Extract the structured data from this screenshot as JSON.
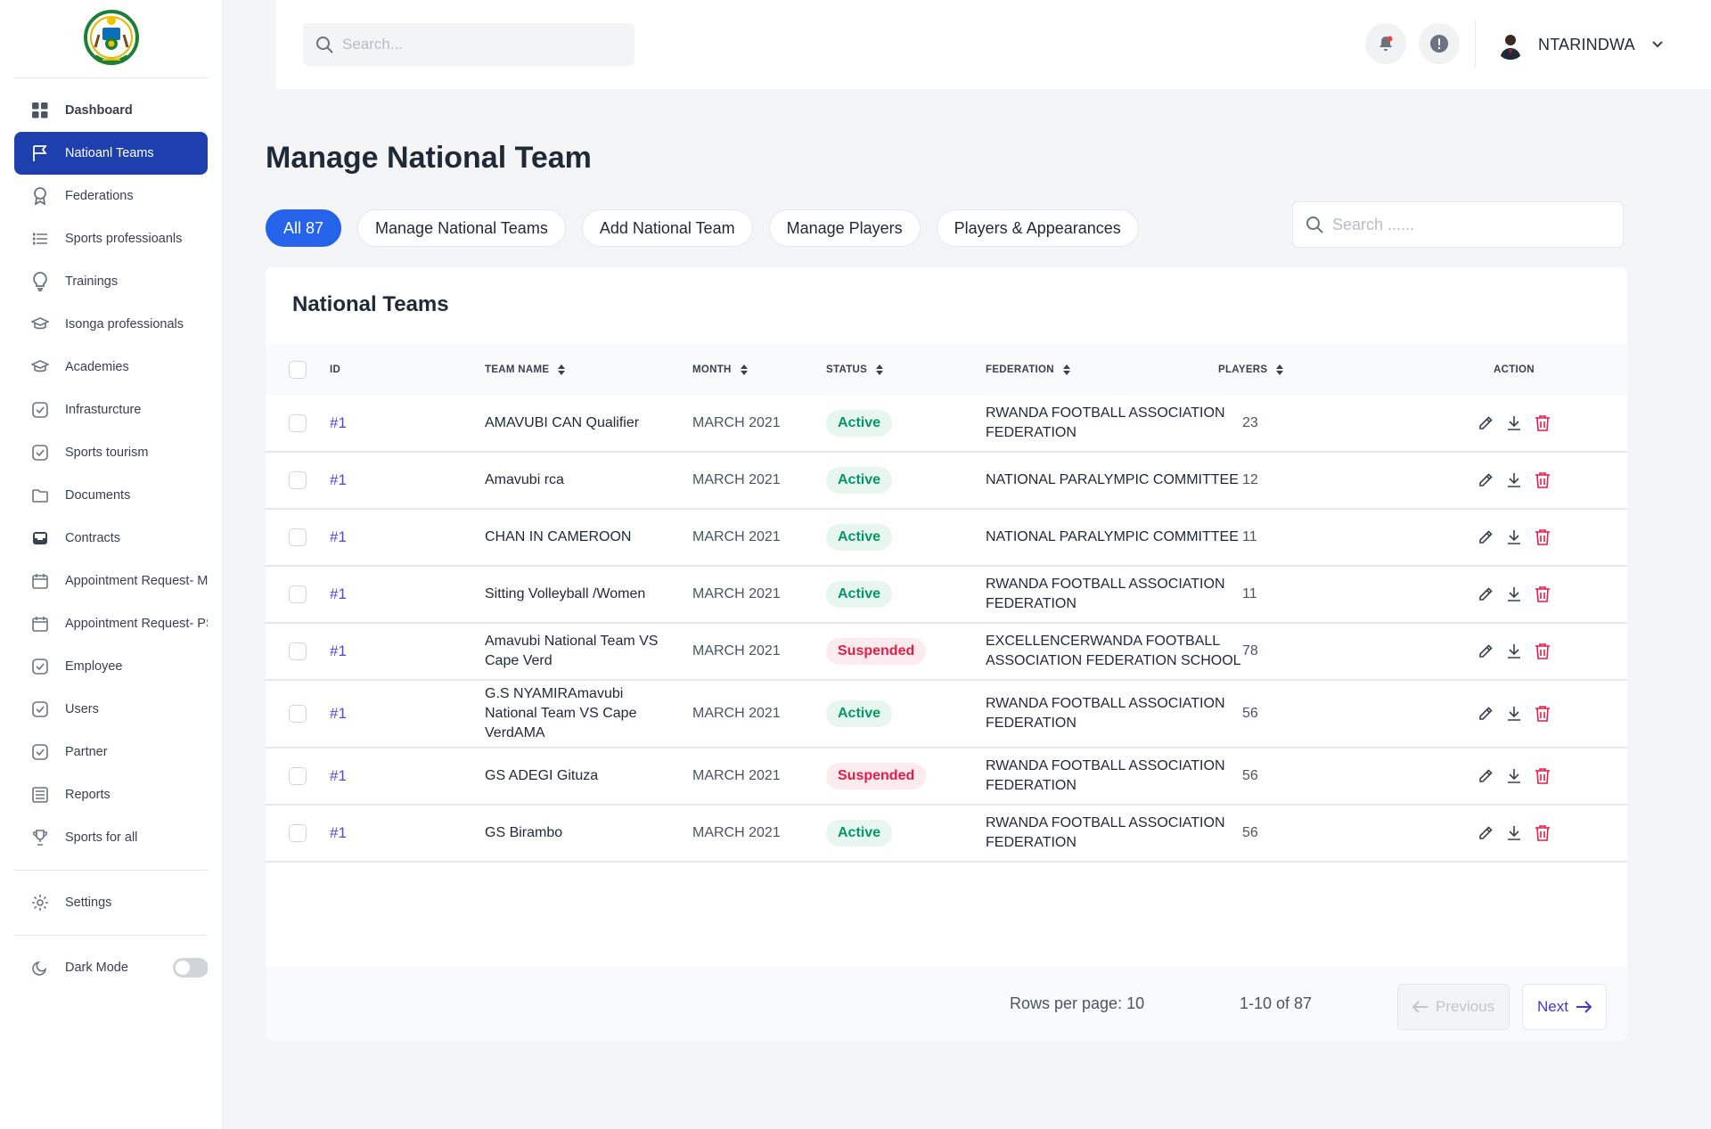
{
  "sidebar": {
    "items": [
      {
        "label": "Dashboard",
        "icon": "grid-icon"
      },
      {
        "label": "Natioanl Teams",
        "icon": "flag-icon"
      },
      {
        "label": "Federations",
        "icon": "award-icon"
      },
      {
        "label": "Sports professioanls",
        "icon": "list-icon"
      },
      {
        "label": "Trainings",
        "icon": "lightbulb-icon"
      },
      {
        "label": "Isonga professionals",
        "icon": "graduation-cap-icon"
      },
      {
        "label": "Academies",
        "icon": "graduation-cap-icon"
      },
      {
        "label": "Infrasturcture",
        "icon": "check-square-icon"
      },
      {
        "label": "Sports tourism",
        "icon": "check-square-icon"
      },
      {
        "label": "Documents",
        "icon": "folder-icon"
      },
      {
        "label": "Contracts",
        "icon": "inbox-icon"
      },
      {
        "label": "Appointment Request- MINISTER",
        "icon": "calendar-icon"
      },
      {
        "label": "Appointment Request- PS",
        "icon": "calendar-icon"
      },
      {
        "label": "Employee",
        "icon": "check-square-icon"
      },
      {
        "label": "Users",
        "icon": "check-square-icon"
      },
      {
        "label": "Partner",
        "icon": "check-square-icon"
      },
      {
        "label": "Reports",
        "icon": "report-icon"
      },
      {
        "label": "Sports for all",
        "icon": "trophy-icon"
      }
    ],
    "settings": "Settings",
    "dark_mode": "Dark Mode"
  },
  "topbar": {
    "search_placeholder": "Search...",
    "user_name": "NTARINDWA"
  },
  "main": {
    "title": "Manage National Team",
    "tabs": [
      {
        "label": "All 87"
      },
      {
        "label": "Manage National Teams"
      },
      {
        "label": "Add National Team"
      },
      {
        "label": "Manage Players"
      },
      {
        "label": "Players & Appearances"
      }
    ],
    "search_placeholder": "Search ......",
    "card_title": "National Teams",
    "columns": {
      "id": "ID",
      "team_name": "TEAM NAME",
      "month": "MONTH",
      "status": "STATUS",
      "federation": "FEDERATION",
      "players": "PLAYERS",
      "action": "ACTION"
    },
    "rows": [
      {
        "id": "#1",
        "team": "AMAVUBI CAN Qualifier",
        "month": "MARCH 2021",
        "status": "Active",
        "federation": "RWANDA FOOTBALL ASSOCIATION FEDERATION",
        "players": "23"
      },
      {
        "id": "#1",
        "team": "Amavubi rca",
        "month": "MARCH 2021",
        "status": "Active",
        "federation": "NATIONAL PARALYMPIC COMMITTEE",
        "players": "12"
      },
      {
        "id": "#1",
        "team": "CHAN IN CAMEROON",
        "month": "MARCH 2021",
        "status": "Active",
        "federation": "NATIONAL PARALYMPIC COMMITTEE",
        "players": "11"
      },
      {
        "id": "#1",
        "team": "Sitting Volleyball /Women",
        "month": "MARCH 2021",
        "status": "Active",
        "federation": "RWANDA FOOTBALL ASSOCIATION FEDERATION",
        "players": "11"
      },
      {
        "id": "#1",
        "team": "Amavubi National Team VS Cape Verd",
        "month": "MARCH 2021",
        "status": "Suspended",
        "federation": "EXCELLENCERWANDA FOOTBALL ASSOCIATION FEDERATION SCHOOL",
        "players": "78"
      },
      {
        "id": "#1",
        "team": "G.S NYAMIRAmavubi National Team VS Cape VerdAMA",
        "month": "MARCH 2021",
        "status": "Active",
        "federation": "RWANDA FOOTBALL ASSOCIATION FEDERATION",
        "players": "56"
      },
      {
        "id": "#1",
        "team": "GS ADEGI Gituza",
        "month": "MARCH 2021",
        "status": "Suspended",
        "federation": "RWANDA FOOTBALL ASSOCIATION FEDERATION",
        "players": "56"
      },
      {
        "id": "#1",
        "team": "GS Birambo",
        "month": "MARCH 2021",
        "status": "Active",
        "federation": "RWANDA FOOTBALL ASSOCIATION FEDERATION",
        "players": "56"
      }
    ],
    "pagination": {
      "rows_per_page": "Rows per page: 10",
      "range": "1-10 of 87",
      "previous": "Previous",
      "next": "Next"
    }
  },
  "colors": {
    "primary": "#1e3fae",
    "accent": "#2563eb",
    "active_green": "#059669",
    "suspended_red": "#e11d48",
    "id_link": "#4f46e5"
  }
}
